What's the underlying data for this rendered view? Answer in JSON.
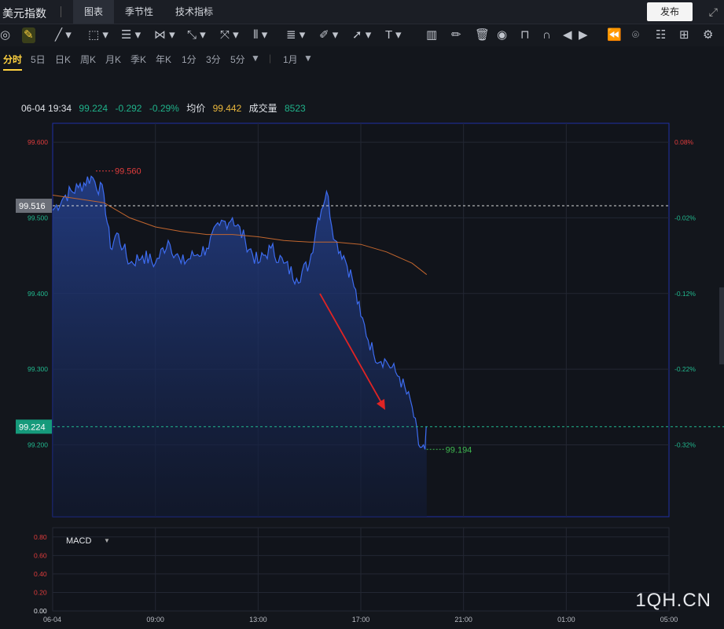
{
  "header": {
    "app_title": "美元指数",
    "tabs": [
      "图表",
      "季节性",
      "技术指标"
    ],
    "publish_label": "发布"
  },
  "toolbar": {
    "icons": [
      "target-icon",
      "pencil-icon",
      "line-icon",
      "rectangle-icon",
      "parallel-icon",
      "pattern-icon",
      "measure-icon",
      "fib-icon",
      "grid-icon",
      "channel-icon",
      "brush-icon",
      "arrow-icon",
      "text-icon",
      "bar-chart-icon",
      "edit-icon",
      "trash-icon",
      "eye-icon",
      "lock-icon",
      "magnet-icon",
      "prev-icon",
      "next-icon",
      "rewind-icon",
      "camera-icon",
      "list-icon",
      "layout-icon",
      "settings-icon"
    ]
  },
  "periods": [
    "分时",
    "5日",
    "日K",
    "周K",
    "月K",
    "季K",
    "年K",
    "1分",
    "3分",
    "5分",
    "1月"
  ],
  "info": {
    "datetime": "06-04 19:34",
    "price": "99.224",
    "change": "-0.292",
    "change_pct": "-0.29%",
    "avg_label": "均价",
    "avg_value": "99.442",
    "volume_label": "成交量",
    "volume_value": "8523"
  },
  "chart_data": {
    "type": "line",
    "title": "",
    "x_ticks": [
      "06-04",
      "09:00",
      "13:00",
      "17:00",
      "21:00",
      "01:00",
      "05:00"
    ],
    "y_ticks": [
      "99.600",
      "99.500",
      "99.400",
      "99.300",
      "99.200"
    ],
    "y_right_ticks": [
      "0.08%",
      "-0.02%",
      "-0.12%",
      "-0.22%",
      "-0.32%"
    ],
    "ylim": [
      99.105,
      99.625
    ],
    "prev_close": 99.516,
    "current_price": 99.224,
    "high_label": "99.560",
    "low_label": "99.194",
    "colors": {
      "price": "#3d6cf0",
      "avg": "#c2662e",
      "up": "#e03c3c",
      "down": "#21b88e"
    },
    "series": [
      {
        "x": [
          "05:00",
          "05:30",
          "06:00",
          "06:30",
          "07:00",
          "07:15",
          "07:30",
          "07:45",
          "08:00",
          "08:30",
          "09:00",
          "09:30",
          "10:00",
          "10:30",
          "11:00",
          "11:30",
          "12:00",
          "12:30",
          "13:00",
          "13:30",
          "14:00",
          "14:30",
          "15:00",
          "15:20",
          "15:40",
          "16:00",
          "16:20",
          "16:40",
          "17:00",
          "17:30",
          "18:00",
          "18:30",
          "19:00",
          "19:15",
          "19:30",
          "19:34"
        ],
        "values": [
          99.51,
          99.53,
          99.54,
          99.555,
          99.53,
          99.46,
          99.48,
          99.46,
          99.44,
          99.45,
          99.44,
          99.47,
          99.44,
          99.45,
          99.46,
          99.49,
          99.5,
          99.47,
          99.44,
          99.46,
          99.44,
          99.42,
          99.44,
          99.5,
          99.535,
          99.47,
          99.45,
          99.42,
          99.37,
          99.32,
          99.31,
          99.29,
          99.25,
          99.2,
          99.194,
          99.224
        ]
      },
      {
        "x": [
          "05:00",
          "06:00",
          "07:00",
          "08:00",
          "09:00",
          "10:00",
          "11:00",
          "12:00",
          "13:00",
          "14:00",
          "15:00",
          "16:00",
          "17:00",
          "18:00",
          "19:00",
          "19:34"
        ],
        "values": [
          99.53,
          99.525,
          99.52,
          99.5,
          99.488,
          99.482,
          99.478,
          99.478,
          99.475,
          99.47,
          99.468,
          99.468,
          99.465,
          99.455,
          99.44,
          99.425
        ]
      }
    ],
    "macd": {
      "label": "MACD",
      "y_ticks": [
        "0.80",
        "0.60",
        "0.40",
        "0.20",
        "0.00"
      ]
    }
  },
  "watermark": "1QH.CN"
}
